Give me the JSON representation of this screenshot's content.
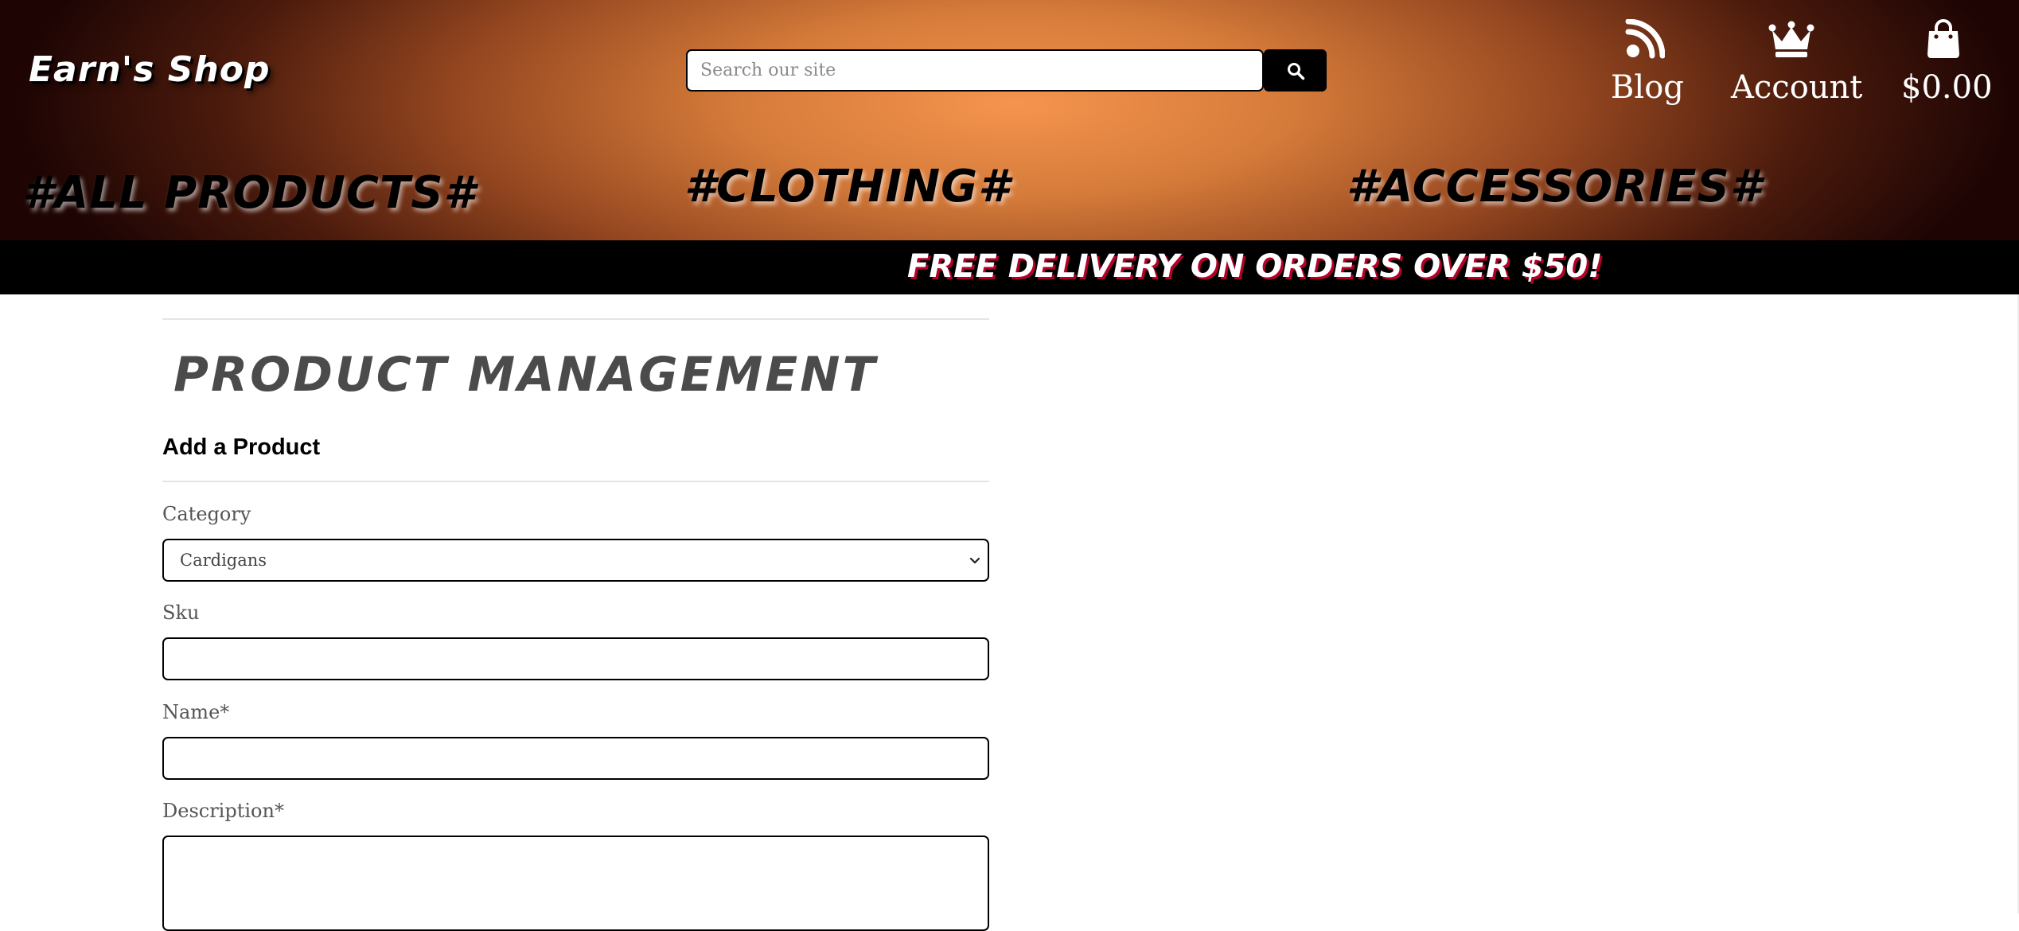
{
  "header": {
    "brand": "Earn's Shop",
    "search": {
      "placeholder": "Search our site",
      "value": ""
    },
    "nav": {
      "blog_label": "Blog",
      "account_label": "Account",
      "cart_total": "$0.00"
    },
    "categories": [
      "#ALL PRODUCTS#",
      "#CLOTHING#",
      "#ACCESSORIES#"
    ],
    "icons": [
      "search-icon",
      "blog-feed-icon",
      "crown-icon",
      "shopping-bag-icon"
    ]
  },
  "banner": {
    "text": "FREE DELIVERY ON ORDERS OVER $50!"
  },
  "main": {
    "page_title": "PRODUCT MANAGEMENT",
    "section_title": "Add a Product",
    "fields": {
      "category": {
        "label": "Category",
        "selected": "Cardigans"
      },
      "sku": {
        "label": "Sku",
        "value": ""
      },
      "name": {
        "label": "Name*",
        "value": ""
      },
      "description": {
        "label": "Description*",
        "value": ""
      }
    }
  },
  "colors": {
    "header_glow": "#f5944e",
    "header_edge": "#1e0504",
    "banner_bg": "#000000",
    "banner_shadow": "#b3002a",
    "title_text": "#4b4b4b"
  }
}
